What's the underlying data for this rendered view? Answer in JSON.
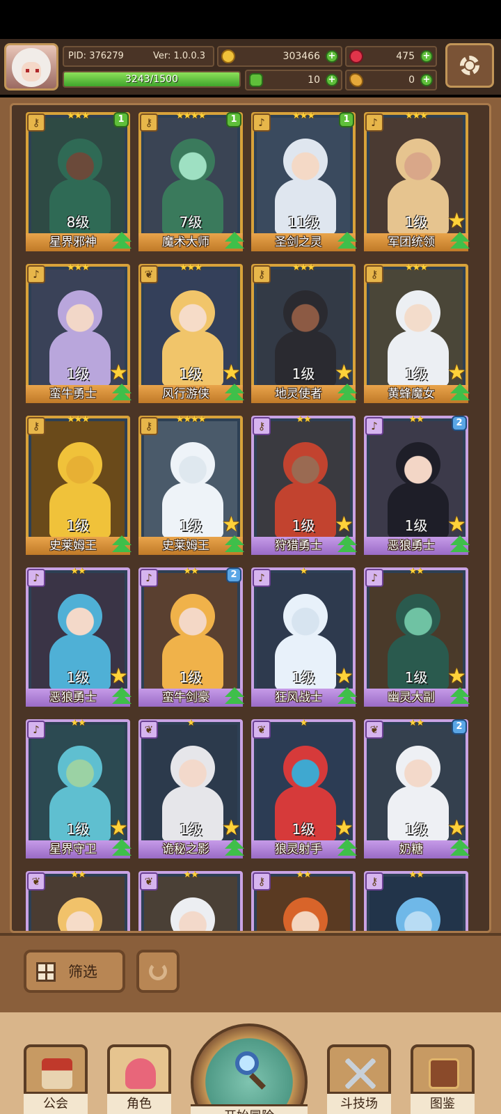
{
  "header": {
    "pid": "PID: 376279",
    "version": "Ver: 1.0.0.3",
    "gold": "303466",
    "gems": "475",
    "exp_text": "3243/1500",
    "exp_fill": 1.0,
    "clover": "10",
    "bean": "0",
    "plus_label": "+"
  },
  "cards": [
    {
      "name": "星界邪神",
      "level": "8级",
      "stars": "★★★",
      "rarity": "gold",
      "badge": "1",
      "badge_color": "green",
      "rank_star": false,
      "icon": "key-icon",
      "art": {
        "bg": "#2e4a44",
        "hair": "#2f6a55",
        "skin": "#6b4a3a"
      }
    },
    {
      "name": "魔术大师",
      "level": "7级",
      "stars": "★★★★",
      "rarity": "gold",
      "badge": "1",
      "badge_color": "green",
      "rank_star": false,
      "icon": "key-icon",
      "art": {
        "bg": "#3a4454",
        "hair": "#3a7a5c",
        "skin": "#9ee0c2"
      }
    },
    {
      "name": "圣剑之灵",
      "level": "11级",
      "stars": "★★★",
      "rarity": "gold",
      "badge": "1",
      "badge_color": "green",
      "rank_star": false,
      "icon": "bell-icon",
      "art": {
        "bg": "#3a4a5e",
        "hair": "#dfe6ef",
        "skin": "#f4d9c6"
      }
    },
    {
      "name": "军团统领",
      "level": "1级",
      "stars": "★★★",
      "rarity": "gold",
      "badge": "",
      "badge_color": "",
      "rank_star": true,
      "icon": "bell-icon",
      "art": {
        "bg": "#4a3a32",
        "hair": "#e6c48f",
        "skin": "#d9a789"
      }
    },
    {
      "name": "蛮牛勇士",
      "level": "1级",
      "stars": "★★★",
      "rarity": "gold",
      "badge": "",
      "badge_color": "",
      "rank_star": true,
      "icon": "bell-icon",
      "art": {
        "bg": "#3a4258",
        "hair": "#b9a6dc",
        "skin": "#f2d7c8"
      }
    },
    {
      "name": "风行游侠",
      "level": "1级",
      "stars": "★★★",
      "rarity": "gold",
      "badge": "",
      "badge_color": "",
      "rank_star": true,
      "icon": "leaf-icon",
      "art": {
        "bg": "#34405a",
        "hair": "#f1c56a",
        "skin": "#f6dcc8"
      }
    },
    {
      "name": "地灵使者",
      "level": "1级",
      "stars": "★★★",
      "rarity": "gold",
      "badge": "",
      "badge_color": "",
      "rank_star": true,
      "icon": "key-icon",
      "art": {
        "bg": "#333a46",
        "hair": "#2a2a30",
        "skin": "#8c5a44"
      }
    },
    {
      "name": "黄蜂魔女",
      "level": "1级",
      "stars": "★★★",
      "rarity": "gold",
      "badge": "",
      "badge_color": "",
      "rank_star": true,
      "icon": "key-icon",
      "art": {
        "bg": "#4a4638",
        "hair": "#eceff3",
        "skin": "#f3dccb"
      }
    },
    {
      "name": "史莱姆王",
      "level": "1级",
      "stars": "★★★",
      "rarity": "gold",
      "badge": "",
      "badge_color": "",
      "rank_star": false,
      "icon": "key-icon",
      "art": {
        "bg": "#6a4a1a",
        "hair": "#f0c23a",
        "skin": "#e7b034"
      }
    },
    {
      "name": "史莱姆王",
      "level": "1级",
      "stars": "★★★★",
      "rarity": "gold",
      "badge": "",
      "badge_color": "",
      "rank_star": true,
      "icon": "key-icon",
      "art": {
        "bg": "#4a5a6a",
        "hair": "#eef3f8",
        "skin": "#dfe8ef"
      }
    },
    {
      "name": "狩猎勇士",
      "level": "1级",
      "stars": "★★",
      "rarity": "purple",
      "badge": "",
      "badge_color": "",
      "rank_star": true,
      "icon": "key-icon",
      "art": {
        "bg": "#3a3a40",
        "hair": "#c2432f",
        "skin": "#9a6a52"
      }
    },
    {
      "name": "恶狼勇士",
      "level": "1级",
      "stars": "★★",
      "rarity": "purple",
      "badge": "2",
      "badge_color": "blue",
      "rank_star": true,
      "icon": "bell-icon",
      "art": {
        "bg": "#3c3a4a",
        "hair": "#1e1e28",
        "skin": "#f3d6c6"
      }
    },
    {
      "name": "恶狼勇士",
      "level": "1级",
      "stars": "★★",
      "rarity": "purple",
      "badge": "",
      "badge_color": "",
      "rank_star": true,
      "icon": "bell-icon",
      "art": {
        "bg": "#3a3446",
        "hair": "#4fb0d6",
        "skin": "#f4d9c9"
      }
    },
    {
      "name": "蛮牛剑豪",
      "level": "1级",
      "stars": "★★",
      "rarity": "purple",
      "badge": "2",
      "badge_color": "blue",
      "rank_star": false,
      "icon": "bell-icon",
      "art": {
        "bg": "#5a4030",
        "hair": "#f0b24a",
        "skin": "#f4d8c6"
      }
    },
    {
      "name": "狂风战士",
      "level": "1级",
      "stars": "★",
      "rarity": "purple",
      "badge": "",
      "badge_color": "",
      "rank_star": true,
      "icon": "bell-icon",
      "art": {
        "bg": "#2e3a4e",
        "hair": "#e8f1fa",
        "skin": "#d7e4f0"
      }
    },
    {
      "name": "幽灵大副",
      "level": "1级",
      "stars": "★★",
      "rarity": "purple",
      "badge": "",
      "badge_color": "",
      "rank_star": true,
      "icon": "bell-icon",
      "art": {
        "bg": "#4a3a2a",
        "hair": "#2a5a4e",
        "skin": "#6fc2a3"
      }
    },
    {
      "name": "星界守卫",
      "level": "1级",
      "stars": "★★",
      "rarity": "purple",
      "badge": "",
      "badge_color": "",
      "rank_star": true,
      "icon": "bell-icon",
      "art": {
        "bg": "#2c4a52",
        "hair": "#5fbfd0",
        "skin": "#9bd2a4"
      }
    },
    {
      "name": "诡秘之影",
      "level": "1级",
      "stars": "★",
      "rarity": "purple",
      "badge": "",
      "badge_color": "",
      "rank_star": true,
      "icon": "leaf-icon",
      "art": {
        "bg": "#2c3a4c",
        "hair": "#e6e6ea",
        "skin": "#f3d9cb"
      }
    },
    {
      "name": "狼灵射手",
      "level": "1级",
      "stars": "★",
      "rarity": "purple",
      "badge": "",
      "badge_color": "",
      "rank_star": true,
      "icon": "leaf-icon",
      "art": {
        "bg": "#2c3c54",
        "hair": "#d63a3a",
        "skin": "#3fa8d0"
      }
    },
    {
      "name": "奶糖",
      "level": "1级",
      "stars": "★★",
      "rarity": "purple",
      "badge": "2",
      "badge_color": "blue",
      "rank_star": true,
      "icon": "leaf-icon",
      "art": {
        "bg": "#34404e",
        "hair": "#eef0f4",
        "skin": "#f3d9ca"
      }
    },
    {
      "name": "",
      "level": "",
      "stars": "★★",
      "rarity": "purple",
      "badge": "",
      "badge_color": "",
      "rank_star": false,
      "icon": "leaf-icon",
      "art": {
        "bg": "#4a3c32",
        "hair": "#f1c26a",
        "skin": "#f6dcc8"
      }
    },
    {
      "name": "",
      "level": "",
      "stars": "★★",
      "rarity": "purple",
      "badge": "",
      "badge_color": "",
      "rank_star": false,
      "icon": "leaf-icon",
      "art": {
        "bg": "#4a4036",
        "hair": "#eceef2",
        "skin": "#f3d9ca"
      }
    },
    {
      "name": "",
      "level": "",
      "stars": "★★",
      "rarity": "purple",
      "badge": "",
      "badge_color": "",
      "rank_star": false,
      "icon": "key-icon",
      "art": {
        "bg": "#5a3a22",
        "hair": "#d8642a",
        "skin": "#f4d6c0"
      }
    },
    {
      "name": "",
      "level": "",
      "stars": "★★",
      "rarity": "purple",
      "badge": "",
      "badge_color": "",
      "rank_star": false,
      "icon": "key-icon",
      "art": {
        "bg": "#22344a",
        "hair": "#6fb8e8",
        "skin": "#b8dcf4"
      }
    }
  ],
  "filter": {
    "label": "筛选"
  },
  "nav": {
    "guild": "公会",
    "character": "角色",
    "adventure": "开始冒险",
    "arena": "斗技场",
    "codex": "图鉴"
  }
}
